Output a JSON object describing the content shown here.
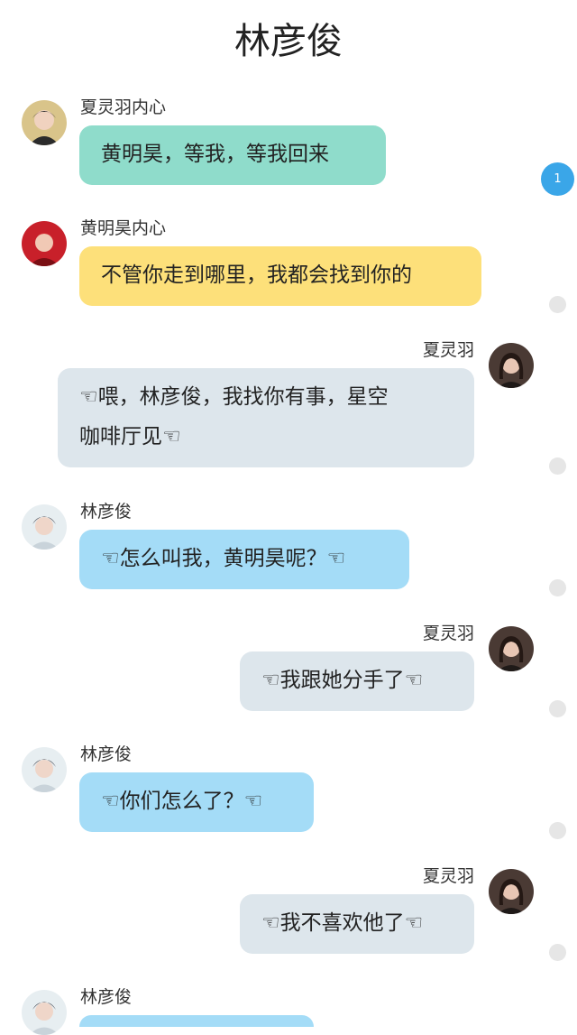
{
  "header": {
    "title": "林彦俊"
  },
  "unread_badge": "1",
  "colors": {
    "teal_bubble": "#8fdccb",
    "yellow_bubble": "#fde07a",
    "gray_bubble": "#dde6ec",
    "blue_bubble": "#a4dcf7",
    "unread_badge": "#3aa6e8",
    "receipt_dot": "#e6e6e6"
  },
  "messages": [
    {
      "sender": "夏灵羽内心",
      "text": "黄明昊，等我，等我回来",
      "side": "left",
      "bubble_color": "teal",
      "avatar": "avatar-boy-dark-hair"
    },
    {
      "sender": "黄明昊内心",
      "text": "不管你走到哪里，我都会找到你的",
      "side": "left",
      "bubble_color": "yellow",
      "avatar": "avatar-boy-red-hair"
    },
    {
      "sender": "夏灵羽",
      "text_line1": "☜喂，林彦俊，我找你有事，星空",
      "text_line2": "咖啡厅见☜",
      "side": "right",
      "bubble_color": "gray",
      "avatar": "avatar-girl"
    },
    {
      "sender": "林彦俊",
      "text": "☜怎么叫我，黄明昊呢？☜",
      "side": "left",
      "bubble_color": "blue",
      "avatar": "avatar-boy-light"
    },
    {
      "sender": "夏灵羽",
      "text": "☜我跟她分手了☜",
      "side": "right",
      "bubble_color": "gray",
      "avatar": "avatar-girl"
    },
    {
      "sender": "林彦俊",
      "text": "☜你们怎么了？☜",
      "side": "left",
      "bubble_color": "blue",
      "avatar": "avatar-boy-light"
    },
    {
      "sender": "夏灵羽",
      "text": "☜我不喜欢他了☜",
      "side": "right",
      "bubble_color": "gray",
      "avatar": "avatar-girl"
    },
    {
      "sender": "林彦俊",
      "text": "",
      "side": "left",
      "bubble_color": "blue",
      "avatar": "avatar-boy-light"
    }
  ]
}
